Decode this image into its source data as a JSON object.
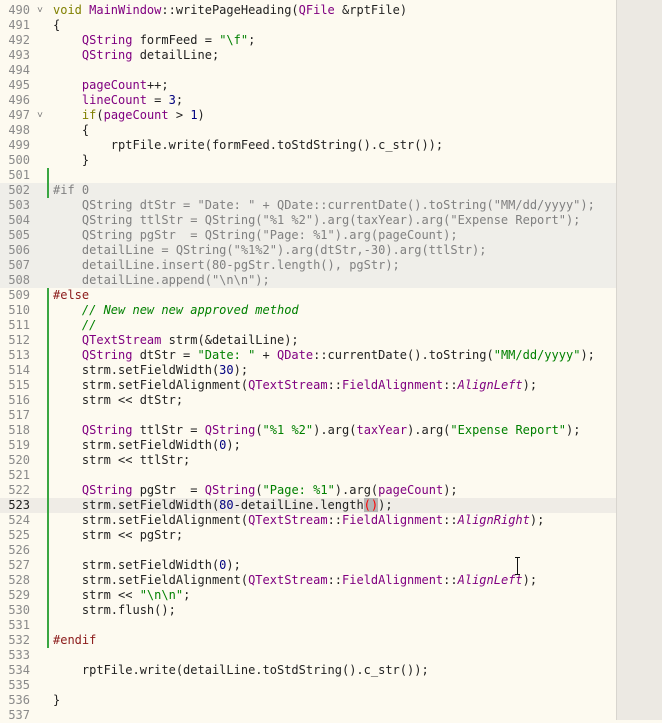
{
  "lines": [
    {
      "n": "490",
      "fold": "˅",
      "segs": [
        [
          "kw",
          "void "
        ],
        [
          "cls",
          "MainWindow"
        ],
        [
          "",
          "::writePageHeading("
        ],
        [
          "cls",
          "QFile "
        ],
        [
          "",
          "&rptFile)"
        ]
      ]
    },
    {
      "n": "491",
      "segs": [
        [
          "",
          "{"
        ]
      ]
    },
    {
      "n": "492",
      "segs": [
        [
          "",
          "    "
        ],
        [
          "ty",
          "QString "
        ],
        [
          "",
          "formFeed = "
        ],
        [
          "st",
          "\"\\f\""
        ],
        [
          "",
          ";"
        ]
      ]
    },
    {
      "n": "493",
      "segs": [
        [
          "",
          "    "
        ],
        [
          "ty",
          "QString "
        ],
        [
          "",
          "detailLine;"
        ]
      ]
    },
    {
      "n": "494",
      "segs": []
    },
    {
      "n": "495",
      "segs": [
        [
          "",
          "    "
        ],
        [
          "ty",
          "pageCount"
        ],
        [
          "",
          "++;"
        ]
      ]
    },
    {
      "n": "496",
      "segs": [
        [
          "",
          "    "
        ],
        [
          "ty",
          "lineCount"
        ],
        [
          "",
          " = "
        ],
        [
          "num",
          "3"
        ],
        [
          "",
          ";"
        ]
      ]
    },
    {
      "n": "497",
      "fold": "˅",
      "segs": [
        [
          "",
          "    "
        ],
        [
          "kw",
          "if"
        ],
        [
          "",
          "("
        ],
        [
          "ty",
          "pageCount"
        ],
        [
          "",
          " > "
        ],
        [
          "num",
          "1"
        ],
        [
          "",
          ")"
        ]
      ]
    },
    {
      "n": "498",
      "segs": [
        [
          "",
          "    {"
        ]
      ]
    },
    {
      "n": "499",
      "segs": [
        [
          "",
          "        rptFile.write(formFeed.toStdString().c_str());"
        ]
      ]
    },
    {
      "n": "500",
      "segs": [
        [
          "",
          "    }"
        ]
      ]
    },
    {
      "n": "501",
      "chg": true,
      "segs": []
    },
    {
      "n": "502",
      "chg": true,
      "inactive": true,
      "segs": [
        [
          "dis",
          "#if 0"
        ]
      ]
    },
    {
      "n": "503",
      "inactive": true,
      "segs": [
        [
          "dis",
          "    QString dtStr = \"Date: \" + QDate::currentDate().toString(\"MM/dd/yyyy\");"
        ]
      ]
    },
    {
      "n": "504",
      "inactive": true,
      "segs": [
        [
          "dis",
          "    QString ttlStr = QString(\"%1 %2\").arg(taxYear).arg(\"Expense Report\");"
        ]
      ]
    },
    {
      "n": "505",
      "inactive": true,
      "segs": [
        [
          "dis",
          "    QString pgStr  = QString(\"Page: %1\").arg(pageCount);"
        ]
      ]
    },
    {
      "n": "506",
      "inactive": true,
      "segs": [
        [
          "dis",
          "    detailLine = QString(\"%1%2\").arg(dtStr,-30).arg(ttlStr);"
        ]
      ]
    },
    {
      "n": "507",
      "inactive": true,
      "segs": [
        [
          "dis",
          "    detailLine.insert(80-pgStr.length(), pgStr);"
        ]
      ]
    },
    {
      "n": "508",
      "inactive": true,
      "segs": [
        [
          "dis",
          "    detailLine.append(\"\\n\\n\");"
        ]
      ]
    },
    {
      "n": "509",
      "chg": true,
      "segs": [
        [
          "pre",
          "#else"
        ]
      ]
    },
    {
      "n": "510",
      "chg": true,
      "segs": [
        [
          "",
          "    "
        ],
        [
          "cm",
          "// New new new approved method"
        ]
      ]
    },
    {
      "n": "511",
      "chg": true,
      "segs": [
        [
          "",
          "    "
        ],
        [
          "cm",
          "//"
        ]
      ]
    },
    {
      "n": "512",
      "chg": true,
      "segs": [
        [
          "",
          "    "
        ],
        [
          "ty",
          "QTextStream "
        ],
        [
          "",
          "strm(&detailLine);"
        ]
      ]
    },
    {
      "n": "513",
      "chg": true,
      "segs": [
        [
          "",
          "    "
        ],
        [
          "ty",
          "QString "
        ],
        [
          "",
          "dtStr = "
        ],
        [
          "st",
          "\"Date: \""
        ],
        [
          "",
          " + "
        ],
        [
          "cls",
          "QDate"
        ],
        [
          "",
          "::currentDate().toString("
        ],
        [
          "st",
          "\"MM/dd/yyyy\""
        ],
        [
          "",
          ");"
        ]
      ]
    },
    {
      "n": "514",
      "chg": true,
      "segs": [
        [
          "",
          "    strm.setFieldWidth("
        ],
        [
          "num",
          "30"
        ],
        [
          "",
          ");"
        ]
      ]
    },
    {
      "n": "515",
      "chg": true,
      "segs": [
        [
          "",
          "    strm.setFieldAlignment("
        ],
        [
          "cls",
          "QTextStream"
        ],
        [
          "",
          "::"
        ],
        [
          "cls",
          "FieldAlignment"
        ],
        [
          "",
          "::"
        ],
        [
          "en",
          "AlignLeft"
        ],
        [
          "",
          ");"
        ]
      ]
    },
    {
      "n": "516",
      "chg": true,
      "segs": [
        [
          "",
          "    strm << dtStr;"
        ]
      ]
    },
    {
      "n": "517",
      "chg": true,
      "segs": []
    },
    {
      "n": "518",
      "chg": true,
      "segs": [
        [
          "",
          "    "
        ],
        [
          "ty",
          "QString "
        ],
        [
          "",
          "ttlStr = "
        ],
        [
          "cls",
          "QString"
        ],
        [
          "",
          "("
        ],
        [
          "st",
          "\"%1 %2\""
        ],
        [
          "",
          ").arg("
        ],
        [
          "ty",
          "taxYear"
        ],
        [
          "",
          ").arg("
        ],
        [
          "st",
          "\"Expense Report\""
        ],
        [
          "",
          ");"
        ]
      ]
    },
    {
      "n": "519",
      "chg": true,
      "segs": [
        [
          "",
          "    strm.setFieldWidth("
        ],
        [
          "num",
          "0"
        ],
        [
          "",
          ");"
        ]
      ]
    },
    {
      "n": "520",
      "chg": true,
      "segs": [
        [
          "",
          "    strm << ttlStr;"
        ]
      ]
    },
    {
      "n": "521",
      "chg": true,
      "segs": []
    },
    {
      "n": "522",
      "chg": true,
      "segs": [
        [
          "",
          "    "
        ],
        [
          "ty",
          "QString "
        ],
        [
          "",
          "pgStr  = "
        ],
        [
          "cls",
          "QString"
        ],
        [
          "",
          "("
        ],
        [
          "st",
          "\"Page: %1\""
        ],
        [
          "",
          ").arg("
        ],
        [
          "ty",
          "pageCount"
        ],
        [
          "",
          ");"
        ]
      ]
    },
    {
      "n": "523",
      "chg": true,
      "current": true,
      "segs": [
        [
          "",
          "    strm.setFieldWidth("
        ],
        [
          "num",
          "80"
        ],
        [
          "",
          "-detailLine.length"
        ],
        [
          "paren-hl",
          "()"
        ],
        [
          "",
          ");"
        ]
      ]
    },
    {
      "n": "524",
      "chg": true,
      "segs": [
        [
          "",
          "    strm.setFieldAlignment("
        ],
        [
          "cls",
          "QTextStream"
        ],
        [
          "",
          "::"
        ],
        [
          "cls",
          "FieldAlignment"
        ],
        [
          "",
          "::"
        ],
        [
          "en",
          "AlignRight"
        ],
        [
          "",
          ");"
        ]
      ]
    },
    {
      "n": "525",
      "chg": true,
      "segs": [
        [
          "",
          "    strm << pgStr;"
        ]
      ]
    },
    {
      "n": "526",
      "chg": true,
      "segs": []
    },
    {
      "n": "527",
      "chg": true,
      "segs": [
        [
          "",
          "    strm.setFieldWidth("
        ],
        [
          "num",
          "0"
        ],
        [
          "",
          ");"
        ]
      ]
    },
    {
      "n": "528",
      "chg": true,
      "segs": [
        [
          "",
          "    strm.setFieldAlignment("
        ],
        [
          "cls",
          "QTextStream"
        ],
        [
          "",
          "::"
        ],
        [
          "cls",
          "FieldAlignment"
        ],
        [
          "",
          "::"
        ],
        [
          "en",
          "AlignLeft"
        ],
        [
          "",
          ");"
        ]
      ]
    },
    {
      "n": "529",
      "chg": true,
      "segs": [
        [
          "",
          "    strm << "
        ],
        [
          "st",
          "\"\\n\\n\""
        ],
        [
          "",
          ";"
        ]
      ]
    },
    {
      "n": "530",
      "chg": true,
      "segs": [
        [
          "",
          "    strm.flush();"
        ]
      ]
    },
    {
      "n": "531",
      "chg": true,
      "segs": []
    },
    {
      "n": "532",
      "chg": true,
      "segs": [
        [
          "pre",
          "#endif"
        ]
      ]
    },
    {
      "n": "533",
      "segs": []
    },
    {
      "n": "534",
      "segs": [
        [
          "",
          "    rptFile.write(detailLine.toStdString().c_str());"
        ]
      ]
    },
    {
      "n": "535",
      "segs": []
    },
    {
      "n": "536",
      "segs": [
        [
          "",
          "}"
        ]
      ]
    },
    {
      "n": "537",
      "segs": []
    }
  ]
}
